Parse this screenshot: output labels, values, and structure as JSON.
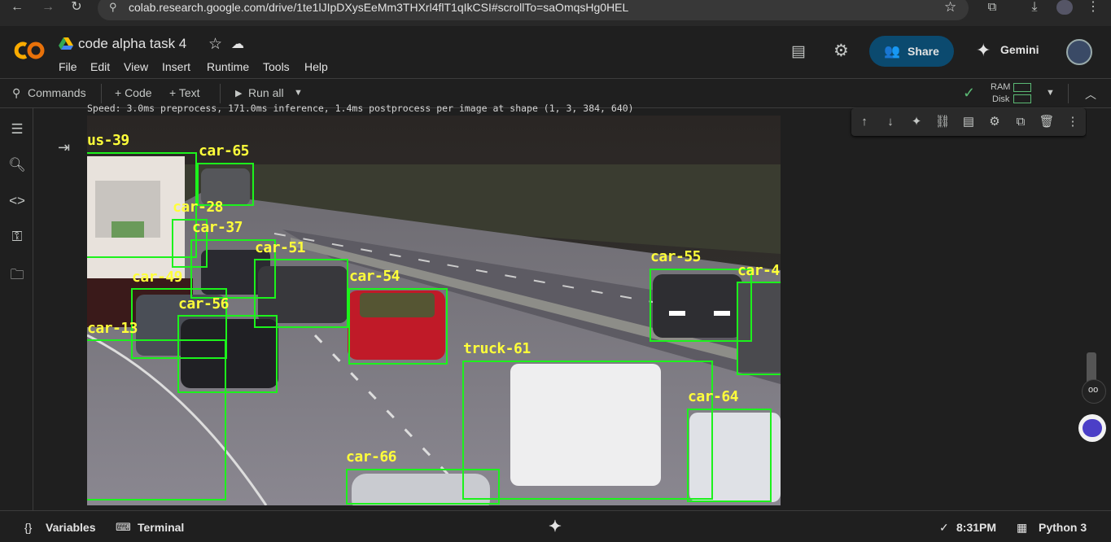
{
  "browser": {
    "url": "colab.research.google.com/drive/1te1lJIpDXysEeMm3THXrl4flT1qIkCSI#scrollTo=saOmqsHg0HEL"
  },
  "header": {
    "notebook_title": "code alpha task 4",
    "menus": [
      "File",
      "Edit",
      "View",
      "Insert",
      "Runtime",
      "Tools",
      "Help"
    ],
    "share_label": "Share",
    "gemini_label": "Gemini"
  },
  "toolbar": {
    "commands": "Commands",
    "code": "+ Code",
    "text": "+ Text",
    "run_all": "Run all",
    "ram": "RAM",
    "disk": "Disk"
  },
  "output": {
    "code_line": "Speed: 3.0ms preprocess, 171.0ms inference, 1.4ms postprocess per image at shape (1, 3, 384, 640)",
    "detections": [
      "us-39",
      "car-65",
      "car-28",
      "car-37",
      "car-51",
      "car-49",
      "car-54",
      "car-56",
      "car-13",
      "car-55",
      "car-4",
      "truck-61",
      "car-64",
      "car-66"
    ]
  },
  "footer": {
    "variables": "Variables",
    "terminal": "Terminal",
    "time": "8:31PM",
    "runtime": "Python 3"
  },
  "colors": {
    "box": "#1cf21c",
    "label": "#ffff3a",
    "share_bg": "#0b4a6f",
    "logo_orange": "#f9ab00"
  }
}
